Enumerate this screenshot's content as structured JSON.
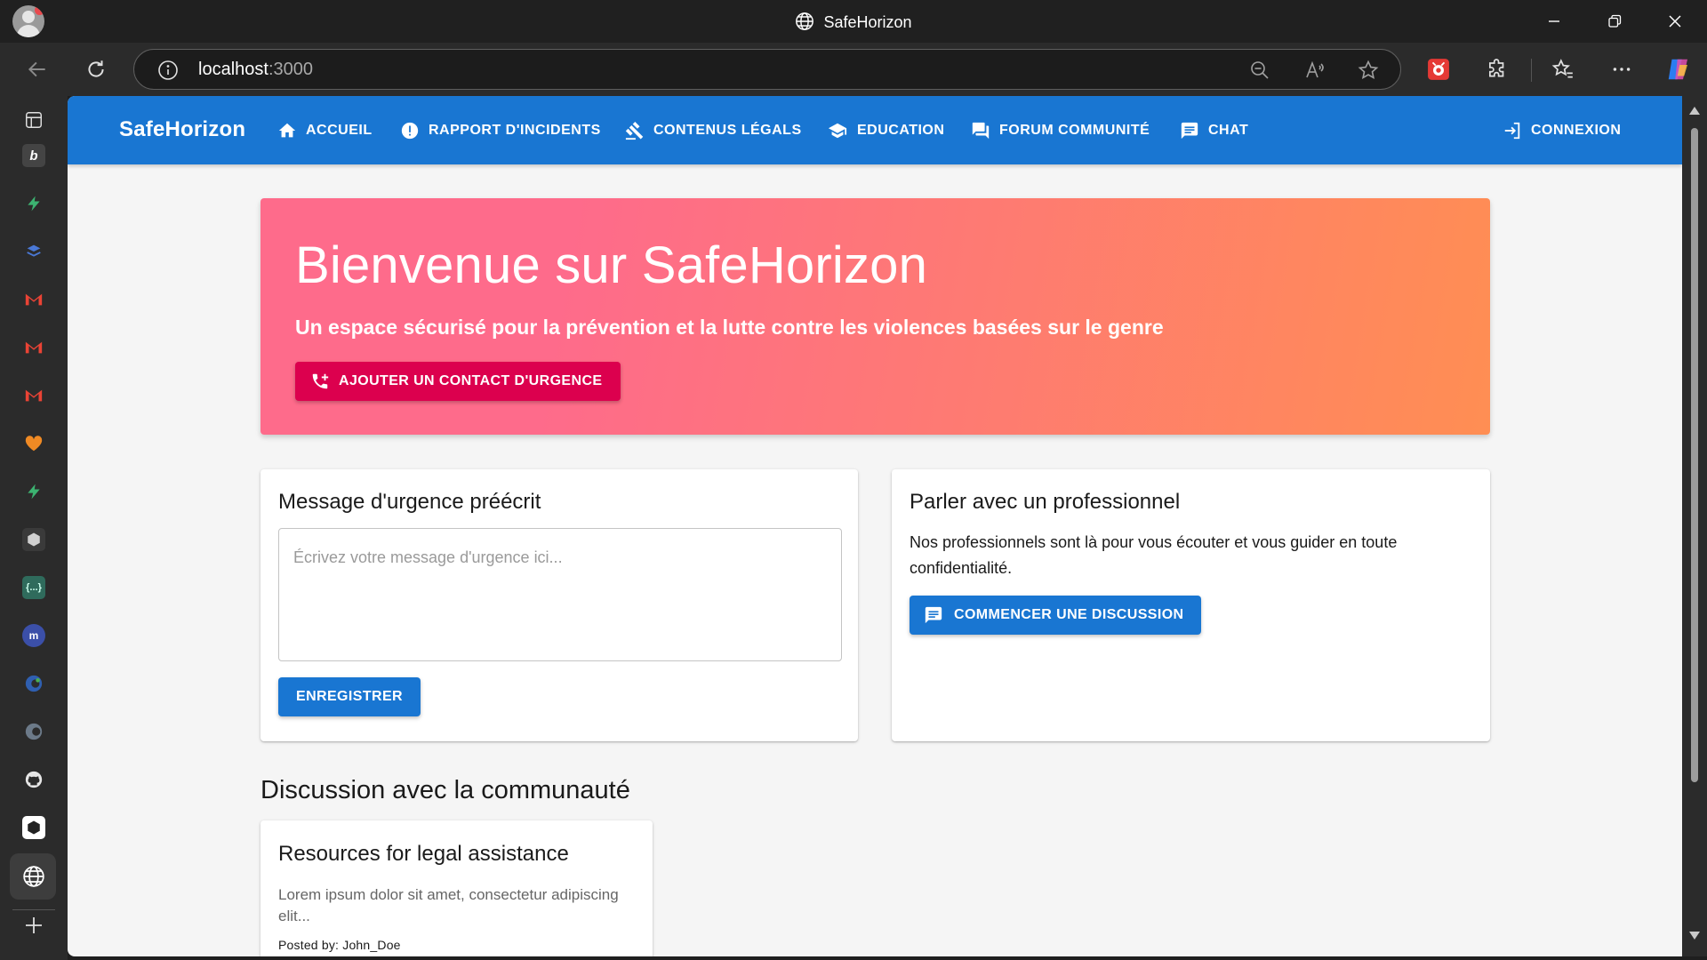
{
  "browser": {
    "window_title": "SafeHorizon",
    "address_host": "localhost",
    "address_port": ":3000"
  },
  "app": {
    "brand": "SafeHorizon",
    "nav": [
      {
        "label": "ACCUEIL",
        "icon": "home-icon"
      },
      {
        "label": "RAPPORT D'INCIDENTS",
        "icon": "report-icon"
      },
      {
        "label": "CONTENUS LÉGALS",
        "icon": "gavel-icon"
      },
      {
        "label": "EDUCATION",
        "icon": "school-icon"
      },
      {
        "label": "FORUM COMMUNITÉ",
        "icon": "forum-icon"
      },
      {
        "label": "CHAT",
        "icon": "chat-icon"
      }
    ],
    "login": {
      "label": "CONNEXION",
      "icon": "login-icon"
    }
  },
  "hero": {
    "title": "Bienvenue sur SafeHorizon",
    "subtitle": "Un espace sécurisé pour la prévention et la lutte contre les violences basées sur le genre",
    "button_label": "AJOUTER UN CONTACT D'URGENCE"
  },
  "emergency_message": {
    "title": "Message d'urgence préécrit",
    "placeholder": "Écrivez votre message d'urgence ici...",
    "save_label": "ENREGISTRER"
  },
  "professional": {
    "title": "Parler avec un professionnel",
    "text": "Nos professionnels sont là pour vous écouter et vous guider en toute confidentialité.",
    "button_label": "COMMENCER UNE DISCUSSION"
  },
  "community": {
    "section_title": "Discussion avec la communauté",
    "posts": [
      {
        "title": "Resources for legal assistance",
        "excerpt": "Lorem ipsum dolor sit amet, consectetur adipiscing elit...",
        "posted_by": "Posted by: John_Doe"
      }
    ]
  },
  "colors": {
    "primary": "#1976d2",
    "secondary": "#dc004e",
    "hero_gradient_start": "#fe6b8b",
    "hero_gradient_end": "#ff8e53"
  }
}
